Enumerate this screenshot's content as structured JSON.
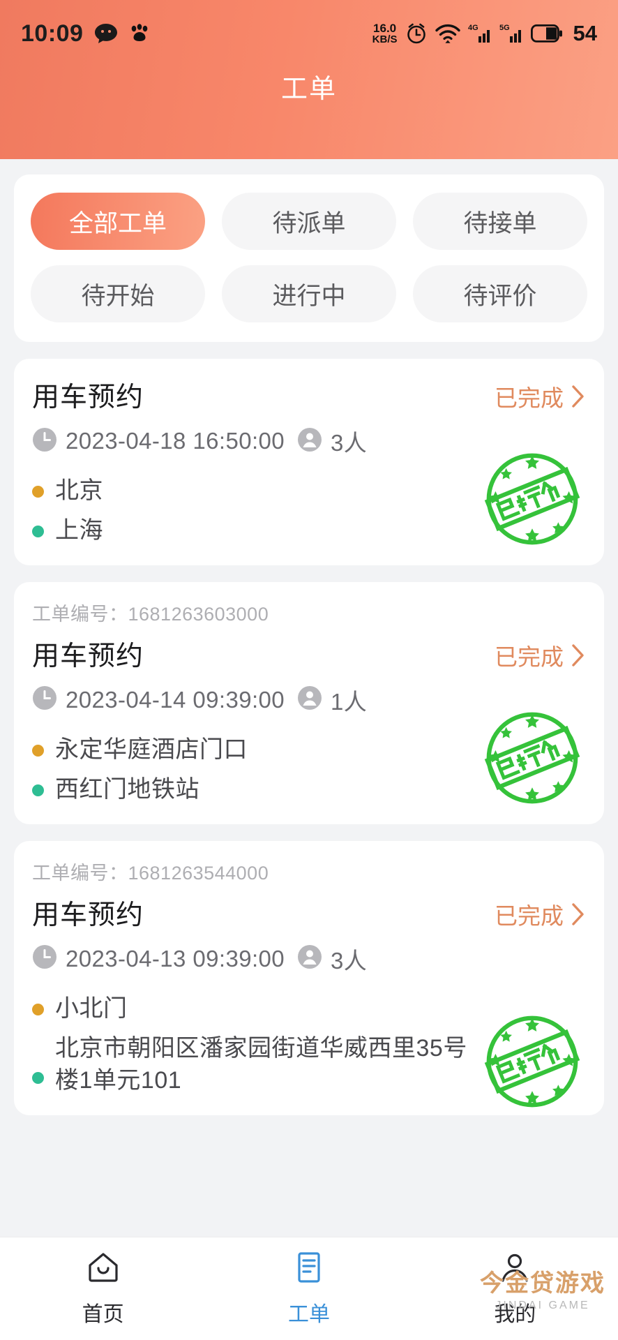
{
  "statusbar": {
    "time": "10:09",
    "net_speed_value": "16.0",
    "net_speed_unit": "KB/S",
    "battery_level": "54",
    "icons": [
      "message-icon",
      "paw-icon",
      "alarm-clock-icon",
      "wifi-icon",
      "signal-4g-icon",
      "signal-5g-icon",
      "battery-icon"
    ]
  },
  "header": {
    "title": "工单",
    "accent": "#f5805f"
  },
  "filters": {
    "chips": [
      {
        "label": "全部工单",
        "active": true
      },
      {
        "label": "待派单",
        "active": false
      },
      {
        "label": "待接单",
        "active": false
      },
      {
        "label": "待开始",
        "active": false
      },
      {
        "label": "进行中",
        "active": false
      },
      {
        "label": "待评价",
        "active": false
      }
    ]
  },
  "orders": {
    "order_no_label": "工单编号：",
    "status_color": "#e08a5e",
    "stamp_label": "已评价",
    "stamp_color": "#35c23a",
    "items": [
      {
        "order_no": "",
        "title": "用车预约",
        "status": "已完成",
        "datetime": "2023-04-18 16:50:00",
        "people": "3人",
        "start": "北京",
        "end": "上海",
        "stamp": "已评价"
      },
      {
        "order_no": "1681263603000",
        "title": "用车预约",
        "status": "已完成",
        "datetime": "2023-04-14 09:39:00",
        "people": "1人",
        "start": "永定华庭酒店门口",
        "end": "西红门地铁站",
        "stamp": "已评价"
      },
      {
        "order_no": "1681263544000",
        "title": "用车预约",
        "status": "已完成",
        "datetime": "2023-04-13 09:39:00",
        "people": "3人",
        "start": "小北门",
        "end": "北京市朝阳区潘家园街道华威西里35号楼1单元101",
        "stamp": "已评价"
      }
    ]
  },
  "tabbar": {
    "items": [
      {
        "label": "首页",
        "icon": "home-icon",
        "active": false
      },
      {
        "label": "工单",
        "icon": "document-list-icon",
        "active": true
      },
      {
        "label": "我的",
        "icon": "person-icon",
        "active": false
      }
    ],
    "active_color": "#3a90d8"
  },
  "watermark": {
    "main": "今金贷游戏",
    "sub": "JINDAI GAME"
  }
}
